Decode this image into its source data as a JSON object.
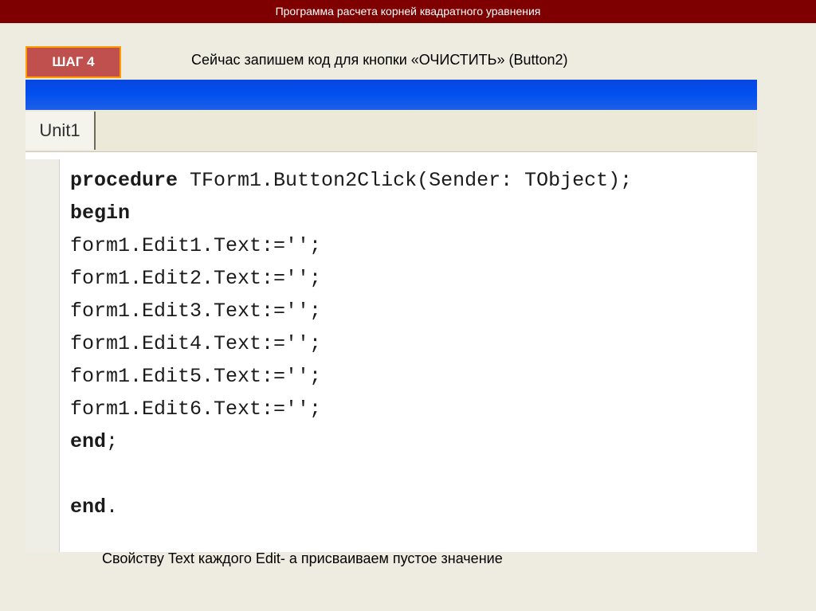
{
  "slide": {
    "title": "Программа расчета корней квадратного уравнения",
    "step_label": "ШАГ 4",
    "heading": "Сейчас запишем код для кнопки «ОЧИСТИТЬ» (Button2)",
    "caption": "Свойству Text каждого Edit- а присваиваем пустое значение"
  },
  "editor": {
    "tab_label": "Unit1",
    "code": [
      {
        "kw": "procedure",
        "rest": " TForm1.Button2Click(Sender: TObject);"
      },
      {
        "kw": "begin",
        "rest": ""
      },
      {
        "kw": "",
        "rest": "form1.Edit1.Text:='';"
      },
      {
        "kw": "",
        "rest": "form1.Edit2.Text:='';"
      },
      {
        "kw": "",
        "rest": "form1.Edit3.Text:='';"
      },
      {
        "kw": "",
        "rest": "form1.Edit4.Text:='';"
      },
      {
        "kw": "",
        "rest": "form1.Edit5.Text:='';"
      },
      {
        "kw": "",
        "rest": "form1.Edit6.Text:='';"
      },
      {
        "kw": "end",
        "rest": ";"
      },
      {
        "kw": "",
        "rest": ""
      },
      {
        "kw": "end",
        "rest": "."
      }
    ]
  },
  "colors": {
    "title_bar": "#7f0000",
    "step_badge": "#c0504d",
    "step_badge_border": "#ff9a00",
    "editor_titlebar": "#0050ef"
  }
}
